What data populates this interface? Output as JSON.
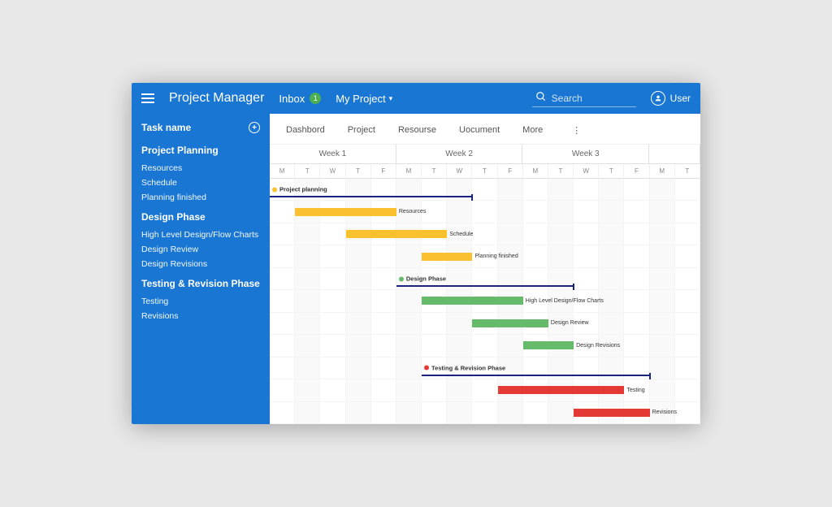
{
  "app": {
    "title": "Project Manager"
  },
  "topbar": {
    "inbox_label": "Inbox",
    "inbox_count": "1",
    "project_dropdown": "My Project",
    "search_placeholder": "Search",
    "user_label": "User"
  },
  "sidebar": {
    "task_name_label": "Task name",
    "groups": [
      {
        "title": "Project Planning",
        "items": [
          "Resources",
          "Schedule",
          "Planning finished"
        ]
      },
      {
        "title": "Design Phase",
        "items": [
          "High Level Design/Flow Charts",
          "Design Review",
          "Design Revisions"
        ]
      },
      {
        "title": "Testing & Revision Phase",
        "items": [
          "Testing",
          "Revisions"
        ]
      }
    ]
  },
  "tabs": [
    "Dashbord",
    "Project",
    "Resourse",
    "Uocument",
    "More"
  ],
  "weeks": [
    "Week 1",
    "Week 2",
    "Week 3"
  ],
  "days": [
    "M",
    "T",
    "W",
    "T",
    "F",
    "M",
    "T",
    "W",
    "T",
    "F",
    "M",
    "T",
    "W",
    "T",
    "F",
    "M",
    "T"
  ],
  "chart_data": {
    "type": "gantt",
    "timeline_unit": "day",
    "columns": 17,
    "tasks": [
      {
        "name": "Project planning",
        "type": "phase",
        "start": 1,
        "end": 8,
        "color": "orange"
      },
      {
        "name": "Resources",
        "type": "task",
        "start": 2,
        "end": 5,
        "color": "orange"
      },
      {
        "name": "Schedule",
        "type": "task",
        "start": 4,
        "end": 7,
        "color": "orange"
      },
      {
        "name": "Planning finished",
        "type": "task",
        "start": 7,
        "end": 8,
        "color": "orange"
      },
      {
        "name": "Design Phase",
        "type": "phase",
        "start": 6,
        "end": 12,
        "color": "green"
      },
      {
        "name": "High Level Design/Flow Charts",
        "type": "task",
        "start": 7,
        "end": 10,
        "color": "green"
      },
      {
        "name": "Design Review",
        "type": "task",
        "start": 9,
        "end": 11,
        "color": "green"
      },
      {
        "name": "Design Revisions",
        "type": "task",
        "start": 11,
        "end": 12,
        "color": "green"
      },
      {
        "name": "Testing & Revision Phase",
        "type": "phase",
        "start": 7,
        "end": 15,
        "color": "red"
      },
      {
        "name": "Testing",
        "type": "task",
        "start": 10,
        "end": 14,
        "color": "red"
      },
      {
        "name": "Revisions",
        "type": "task",
        "start": 13,
        "end": 15,
        "color": "red"
      }
    ]
  }
}
